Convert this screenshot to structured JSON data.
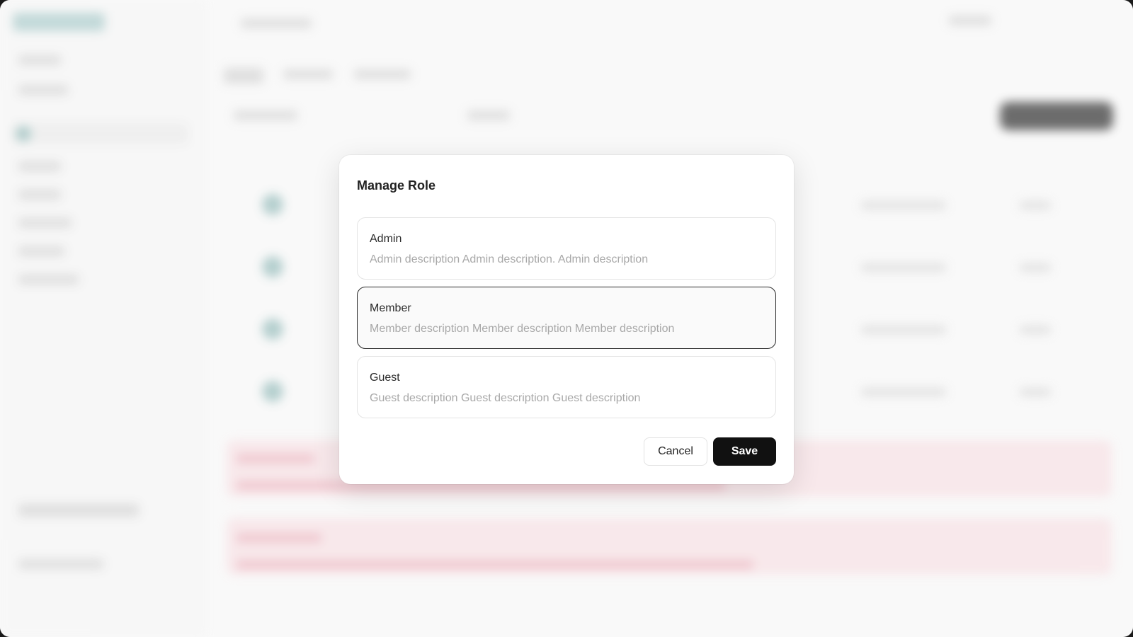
{
  "modal": {
    "title": "Manage Role",
    "roles": [
      {
        "name": "Admin",
        "description": "Admin description Admin description. Admin description",
        "selected": false
      },
      {
        "name": "Member",
        "description": "Member description Member description Member description",
        "selected": true
      },
      {
        "name": "Guest",
        "description": "Guest description Guest description Guest description",
        "selected": false
      }
    ],
    "buttons": {
      "cancel_label": "Cancel",
      "save_label": "Save"
    }
  },
  "colors": {
    "accent": "#111111",
    "background": "#f7f7f7",
    "danger_tint": "#f6dde1",
    "muted_text": "#a8a8a8"
  }
}
